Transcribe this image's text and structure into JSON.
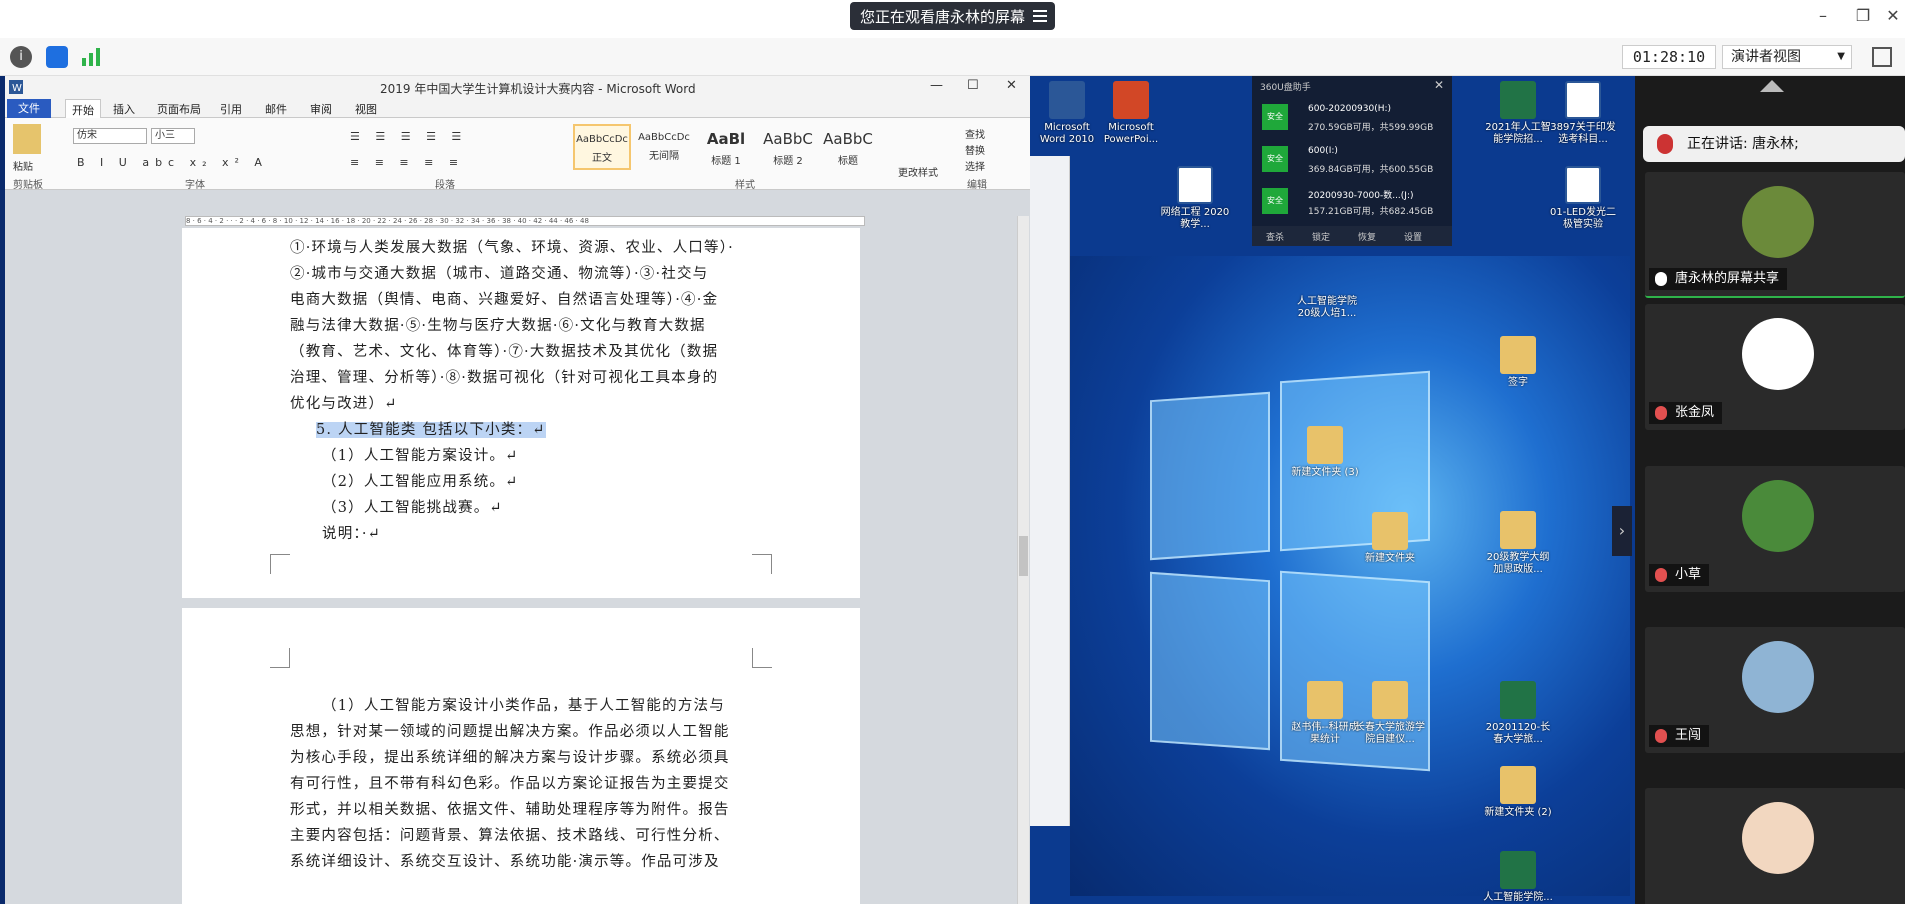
{
  "topbar": {
    "share_notice": "您正在观看唐永林的屏幕",
    "minimize": "–",
    "restore": "❐",
    "close": "✕"
  },
  "toolbar": {
    "timer": "01:28:10",
    "view_mode": "演讲者视图",
    "view_caret": "▼"
  },
  "word": {
    "title": "2019 年中国大学生计算机设计大赛内容 - Microsoft Word",
    "tabs": [
      "文件",
      "开始",
      "插入",
      "页面布局",
      "引用",
      "邮件",
      "审阅",
      "视图"
    ],
    "font_name": "仿宋",
    "font_size": "小三",
    "groups": [
      "剪贴板",
      "字体",
      "段落",
      "样式",
      "编辑"
    ],
    "paste_label": "粘贴",
    "styles": [
      {
        "sample": "AaBbCcDc",
        "name": "正文"
      },
      {
        "sample": "AaBbCcDc",
        "name": "无间隔"
      },
      {
        "sample": "AaBl",
        "name": "标题 1"
      },
      {
        "sample": "AaBbC",
        "name": "标题 2"
      },
      {
        "sample": "AaBbC",
        "name": "标题"
      }
    ],
    "change_styles": "更改样式",
    "edit_items": [
      "查找",
      "替换",
      "选择"
    ],
    "page1_lines": [
      "①·环境与人类发展大数据（气象、环境、资源、农业、人口等）·",
      "②·城市与交通大数据（城市、道路交通、物流等）·③·社交与",
      "电商大数据（舆情、电商、兴趣爱好、自然语言处理等）·④·金",
      "融与法律大数据·⑤·生物与医疗大数据·⑥·文化与教育大数据",
      "（教育、艺术、文化、体育等）·⑦·大数据技术及其优化（数据",
      "治理、管理、分析等）·⑧·数据可视化（针对可视化工具本身的",
      "优化与改进）↵"
    ],
    "highlight_line": "5.  人工智能类  包括以下小类：↵",
    "sub_items": [
      "（1）人工智能方案设计。↵",
      "（2）人工智能应用系统。↵",
      "（3）人工智能挑战赛。↵",
      "说明：·↵"
    ],
    "page2_lines": [
      "（1）人工智能方案设计小类作品，基于人工智能的方法与",
      "思想，针对某一领域的问题提出解决方案。作品必须以人工智能",
      "为核心手段，提出系统详细的解决方案与设计步骤。系统必须具",
      "有可行性，且不带有科幻色彩。作品以方案论证报告为主要提交",
      "形式，并以相关数据、依据文件、辅助处理程序等为附件。报告",
      "主要内容包括：问题背景、算法依据、技术路线、可行性分析、",
      "系统详细设计、系统交互设计、系统功能·演示等。作品可涉及"
    ]
  },
  "desktop": {
    "icons": [
      {
        "label": "Microsoft Word 2010",
        "kind": "word"
      },
      {
        "label": "Microsoft PowerPoi...",
        "kind": "ppt"
      },
      {
        "label": "网络工程 2020教学...",
        "kind": "doc"
      },
      {
        "label": "人工智能学院 20级人培1...",
        "kind": "doc"
      },
      {
        "label": "新建文件夹 (3)",
        "kind": "folder"
      },
      {
        "label": "新建文件夹",
        "kind": "folder"
      },
      {
        "label": "赵书伟--科研成果统计",
        "kind": "folder"
      },
      {
        "label": "长春大学旅游学院自建仪...",
        "kind": "folder"
      },
      {
        "label": "2021年人工智能学院招...",
        "kind": "excel"
      },
      {
        "label": "3897关于印发选考科目...",
        "kind": "doc"
      },
      {
        "label": "01-LED发光二极管实验",
        "kind": "doc"
      },
      {
        "label": "签字",
        "kind": "folder"
      },
      {
        "label": "20级教学大纲加思政版...",
        "kind": "folder"
      },
      {
        "label": "20201120-长春大学旅...",
        "kind": "excel"
      },
      {
        "label": "新建文件夹 (2)",
        "kind": "folder"
      },
      {
        "label": "人工智能学院...",
        "kind": "excel"
      }
    ],
    "usb_helper": {
      "title": "360U盘助手",
      "drives": [
        {
          "badge": "安全",
          "name": "600-20200930(H:)",
          "capacity": "270.59GB可用，共599.99GB"
        },
        {
          "badge": "安全",
          "name": "600(I:)",
          "capacity": "369.84GB可用，共600.55GB"
        },
        {
          "badge": "安全",
          "name": "20200930-7000-数...(J:)",
          "capacity": "157.21GB可用，共682.45GB"
        }
      ],
      "actions": [
        "查杀",
        "锁定",
        "恢复",
        "设置"
      ]
    }
  },
  "panel": {
    "speaking_prefix": "正在讲话: 唐永林;",
    "participants": [
      {
        "name": "唐永林的屏幕共享",
        "muted": false
      },
      {
        "name": "张金凤",
        "muted": true
      },
      {
        "name": "小草",
        "muted": true
      },
      {
        "name": "王闯",
        "muted": true
      },
      {
        "name": "",
        "muted": true
      }
    ]
  }
}
